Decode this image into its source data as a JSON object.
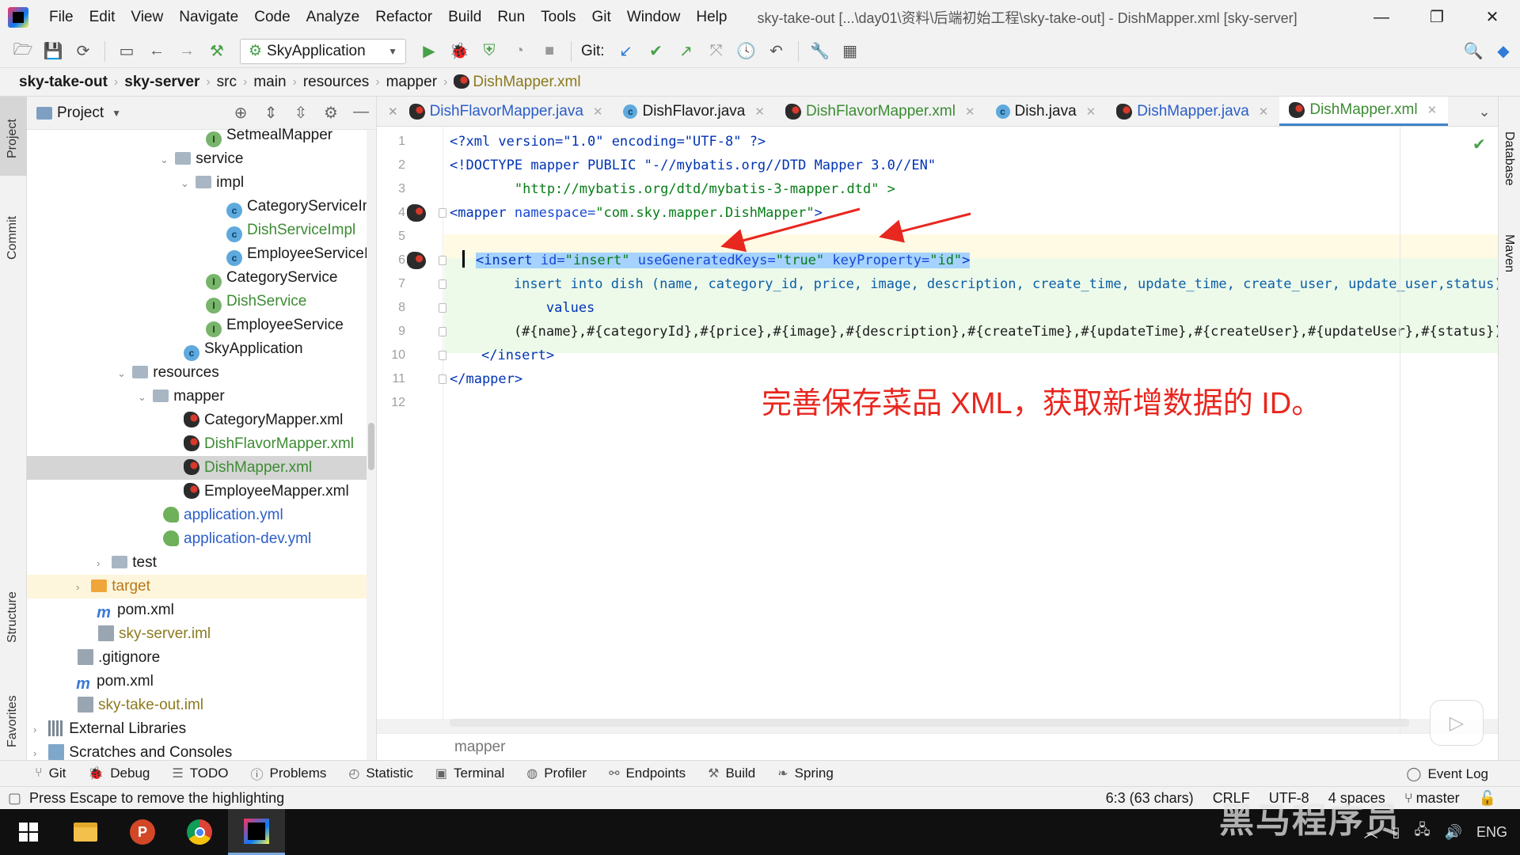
{
  "menu": [
    "File",
    "Edit",
    "View",
    "Navigate",
    "Code",
    "Analyze",
    "Refactor",
    "Build",
    "Run",
    "Tools",
    "Git",
    "Window",
    "Help"
  ],
  "window_title": "sky-take-out [...\\day01\\资料\\后端初始工程\\sky-take-out] - DishMapper.xml [sky-server]",
  "toolbar": {
    "run_config": "SkyApplication",
    "git_label": "Git:"
  },
  "breadcrumb": [
    "sky-take-out",
    "sky-server",
    "src",
    "main",
    "resources",
    "mapper",
    "DishMapper.xml"
  ],
  "left_tabs": {
    "project": "Project",
    "commit": "Commit",
    "structure": "Structure",
    "favorites": "Favorites"
  },
  "right_tabs": {
    "database": "Database",
    "maven": "Maven"
  },
  "project_panel": {
    "title": "Project",
    "tree": [
      {
        "label": "SetmealMapper",
        "icon": "interface-icon"
      },
      {
        "label": "service",
        "icon": "folder-icon"
      },
      {
        "label": "impl",
        "icon": "folder-icon"
      },
      {
        "label": "CategoryServiceIm",
        "icon": "class-icon"
      },
      {
        "label": "DishServiceImpl",
        "icon": "class-icon"
      },
      {
        "label": "EmployeeServiceIm",
        "icon": "class-icon"
      },
      {
        "label": "CategoryService",
        "icon": "interface-icon"
      },
      {
        "label": "DishService",
        "icon": "interface-icon"
      },
      {
        "label": "EmployeeService",
        "icon": "interface-icon"
      },
      {
        "label": "SkyApplication",
        "icon": "spring-boot-class-icon"
      },
      {
        "label": "resources",
        "icon": "resources-folder-icon"
      },
      {
        "label": "mapper",
        "icon": "folder-icon"
      },
      {
        "label": "CategoryMapper.xml",
        "icon": "mybatis-xml-icon"
      },
      {
        "label": "DishFlavorMapper.xml",
        "icon": "mybatis-xml-icon"
      },
      {
        "label": "DishMapper.xml",
        "icon": "mybatis-xml-icon"
      },
      {
        "label": "EmployeeMapper.xml",
        "icon": "mybatis-xml-icon"
      },
      {
        "label": "application.yml",
        "icon": "yml-icon"
      },
      {
        "label": "application-dev.yml",
        "icon": "yml-icon"
      },
      {
        "label": "test",
        "icon": "folder-icon"
      },
      {
        "label": "target",
        "icon": "orange-folder-icon"
      },
      {
        "label": "pom.xml",
        "icon": "maven-icon"
      },
      {
        "label": "sky-server.iml",
        "icon": "iml-file-icon"
      },
      {
        "label": ".gitignore",
        "icon": "file-icon"
      },
      {
        "label": "pom.xml",
        "icon": "maven-icon"
      },
      {
        "label": "sky-take-out.iml",
        "icon": "iml-file-icon"
      },
      {
        "label": "External Libraries",
        "icon": "library-icon"
      },
      {
        "label": "Scratches and Consoles",
        "icon": "scratches-icon"
      }
    ]
  },
  "editor_tabs": [
    {
      "label": "DishFlavorMapper.java",
      "icon": "mybatis-icon"
    },
    {
      "label": "DishFlavor.java",
      "icon": "class-icon"
    },
    {
      "label": "DishFlavorMapper.xml",
      "icon": "mybatis-xml-icon"
    },
    {
      "label": "Dish.java",
      "icon": "class-icon"
    },
    {
      "label": "DishMapper.java",
      "icon": "mybatis-icon"
    },
    {
      "label": "DishMapper.xml",
      "icon": "mybatis-xml-icon",
      "active": true
    }
  ],
  "code": {
    "line_numbers": [
      "1",
      "2",
      "3",
      "4",
      "5",
      "6",
      "7",
      "8",
      "9",
      "10",
      "11",
      "12"
    ],
    "l1": "<?xml version=\"1.0\" encoding=\"UTF-8\" ?>",
    "l2": "<!DOCTYPE mapper PUBLIC \"-//mybatis.org//DTD Mapper 3.0//EN\"",
    "l3": "        \"http://mybatis.org/dtd/mybatis-3-mapper.dtd\" >",
    "l4a": "<mapper ",
    "l4b": "namespace=",
    "l4c": "\"com.sky.mapper.DishMapper\"",
    "l4d": ">",
    "l6a": "<insert ",
    "l6b": "id=",
    "l6c": "\"insert\" ",
    "l6d": "useGeneratedKeys=",
    "l6e": "\"true\" ",
    "l6f": "keyProperty=",
    "l6g": "\"id\"",
    "l6h": ">",
    "l7": "    insert into dish (name, category_id, price, image, description, create_time, update_time, create_user, update_user,status)",
    "l8": "        values",
    "l9": "    (#{name},#{categoryId},#{price},#{image},#{description},#{createTime},#{updateTime},#{createUser},#{updateUser},#{status})",
    "l10": "</insert>",
    "l11": "</mapper>"
  },
  "annotation": "完善保存菜品 XML，获取新增数据的 ID。",
  "editor_breadcrumb": "mapper",
  "bottom_tools": [
    "Git",
    "Debug",
    "TODO",
    "Problems",
    "Statistic",
    "Terminal",
    "Profiler",
    "Endpoints",
    "Build",
    "Spring"
  ],
  "event_log": "Event Log",
  "status": {
    "message": "Press Escape to remove the highlighting",
    "position": "6:3 (63 chars)",
    "line_sep": "CRLF",
    "encoding": "UTF-8",
    "indent": "4 spaces",
    "branch": "master"
  },
  "tray": {
    "lang": "ENG"
  },
  "watermark": "黑马程序员"
}
